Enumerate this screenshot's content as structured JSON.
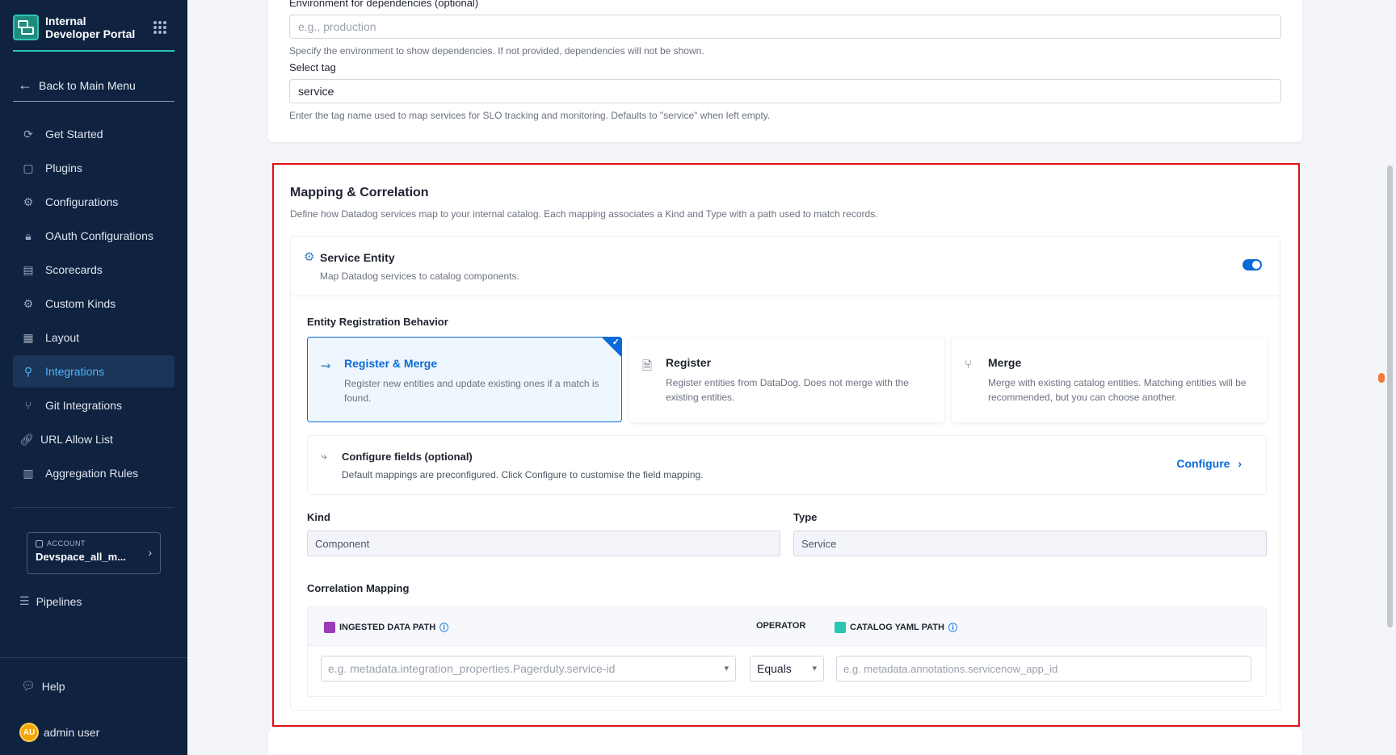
{
  "sidebar": {
    "brand_title": "Internal Developer Portal",
    "back_label": "Back to Main Menu",
    "items": [
      {
        "label": "Get Started",
        "icon": "get-started-icon"
      },
      {
        "label": "Plugins",
        "icon": "plugins-icon"
      },
      {
        "label": "Configurations",
        "icon": "configurations-icon"
      },
      {
        "label": "OAuth Configurations",
        "icon": "lock-icon"
      },
      {
        "label": "Scorecards",
        "icon": "scorecards-icon"
      },
      {
        "label": "Custom Kinds",
        "icon": "gear-icon"
      },
      {
        "label": "Layout",
        "icon": "layout-icon"
      },
      {
        "label": "Integrations",
        "icon": "integrations-icon",
        "active": true
      },
      {
        "label": "Git Integrations",
        "icon": "git-icon"
      },
      {
        "label": "URL Allow List",
        "icon": "link-icon"
      },
      {
        "label": "Aggregation Rules",
        "icon": "aggregation-icon"
      }
    ],
    "account_label": "ACCOUNT",
    "account_name": "Devspace_all_m...",
    "pipelines_label": "Pipelines",
    "help_label": "Help",
    "user_initials": "AU",
    "user_name": "admin user"
  },
  "top_form": {
    "env_label": "Environment for dependencies (optional)",
    "env_placeholder": "e.g., production",
    "env_hint": "Specify the environment to show dependencies. If not provided, dependencies will not be shown.",
    "tag_label": "Select tag",
    "tag_value": "service",
    "tag_hint": "Enter the tag name used to map services for SLO tracking and monitoring. Defaults to \"service\" when left empty."
  },
  "mapping": {
    "title": "Mapping & Correlation",
    "description": "Define how Datadog services map to your internal catalog. Each mapping associates a Kind and Type with a path used to match records.",
    "entity_title": "Service Entity",
    "entity_subtitle": "Map Datadog services to catalog components.",
    "entity_enabled": true,
    "behavior_label": "Entity Registration Behavior",
    "options": [
      {
        "title": "Register & Merge",
        "description": "Register new entities and update existing ones if a match is found.",
        "selected": true
      },
      {
        "title": "Register",
        "description": "Register entities from DataDog. Does not merge with the existing entities.",
        "selected": false
      },
      {
        "title": "Merge",
        "description": "Merge with existing catalog entities. Matching entities will be recommended, but you can choose another.",
        "selected": false
      }
    ],
    "configure_title": "Configure fields (optional)",
    "configure_desc": "Default mappings are preconfigured. Click Configure to customise the field mapping.",
    "configure_button": "Configure",
    "kind_label": "Kind",
    "kind_value": "Component",
    "type_label": "Type",
    "type_value": "Service",
    "correlation_label": "Correlation Mapping",
    "col_ingested": "INGESTED DATA PATH",
    "col_operator": "OPERATOR",
    "col_catalog": "CATALOG YAML PATH",
    "ingested_placeholder": "e.g. metadata.integration_properties.Pagerduty.service-id",
    "operator_value": "Equals",
    "catalog_placeholder": "e.g. metadata.annotations.servicenow_app_id"
  },
  "colors": {
    "sidebar_bg": "#0f2240",
    "accent": "#0a6bd8",
    "brand_teal": "#2dc6b2",
    "highlight_border": "#e0101a"
  }
}
